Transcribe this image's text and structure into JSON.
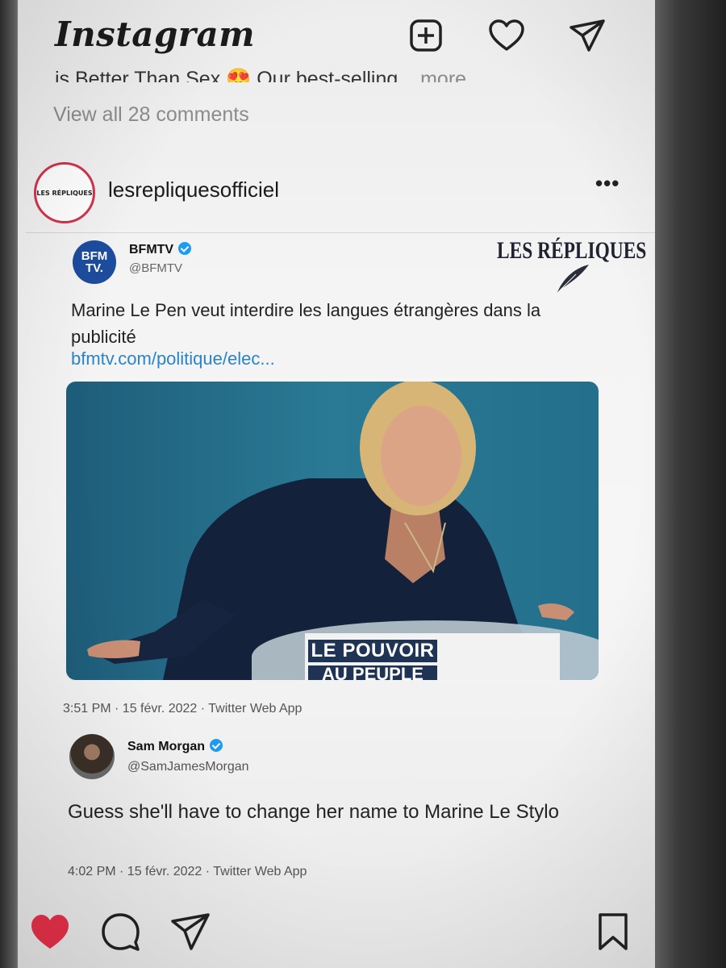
{
  "header": {
    "logo": "Instagram",
    "icons": [
      "new-post-icon",
      "heart-icon",
      "direct-message-icon"
    ]
  },
  "previous_post": {
    "caption_partial": "is Better Than Sex 😍 Our best-selling...",
    "more_label": "more",
    "view_comments": "View all 28 comments"
  },
  "post": {
    "avatar_text": "LES RÉPLIQUES",
    "username": "lesrepliquesofficiel",
    "options_label": "•••",
    "watermark": "LES RÉPLIQUES",
    "tweet": {
      "logo_text": "BFM TV.",
      "name": "BFMTV",
      "handle": "@BFMTV",
      "text": "Marine Le Pen veut interdire les langues étrangères dans la publicité",
      "link": "bfmtv.com/politique/elec...",
      "podium_line1": "LE POUVOIR",
      "podium_line2": "AU PEUPLE",
      "meta": "3:51 PM · 15 févr. 2022 · Twitter Web App"
    },
    "reply": {
      "name": "Sam Morgan",
      "handle": "@SamJamesMorgan",
      "text": "Guess she'll have to change her name to Marine Le Stylo",
      "meta": "4:02 PM · 15 févr. 2022 · Twitter Web App"
    }
  },
  "actions": {
    "like_state": "liked",
    "icons": [
      "heart-filled-icon",
      "comment-icon",
      "share-icon",
      "bookmark-icon"
    ]
  },
  "colors": {
    "like_red": "#e8314a",
    "link_blue": "#2b84c6",
    "verified_blue": "#1d9bf0",
    "bfm_blue": "#1d4c9e"
  }
}
